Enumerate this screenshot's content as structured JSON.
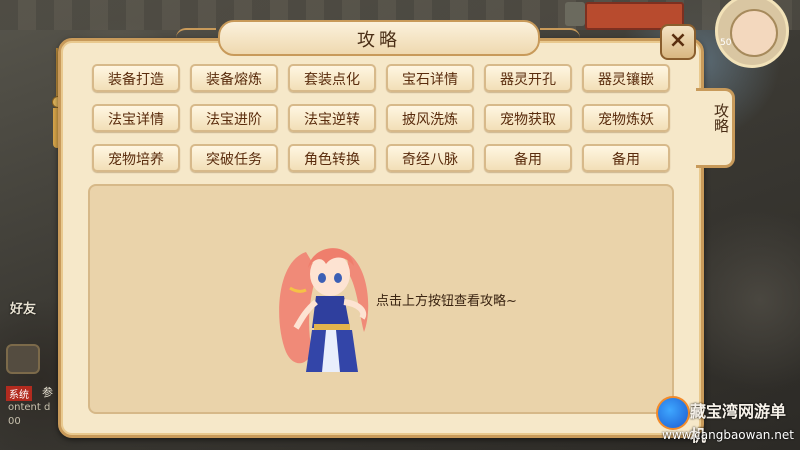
{
  "dialog": {
    "title": "攻略",
    "close_label": "×",
    "side_tab_label": "攻略",
    "hint": "点击上方按钮查看攻略~"
  },
  "guide_buttons": [
    "装备打造",
    "装备熔炼",
    "套装点化",
    "宝石详情",
    "器灵开孔",
    "器灵镶嵌",
    "法宝详情",
    "法宝进阶",
    "法宝逆转",
    "披风洗炼",
    "宠物获取",
    "宠物炼妖",
    "宠物培养",
    "突破任务",
    "角色转换",
    "奇经八脉",
    "备用",
    "备用"
  ],
  "background": {
    "friend_label": "好友",
    "chat_tag": "系统",
    "chat_tag_text": "参",
    "chat_line1": "ontent d",
    "chat_line2": "00",
    "avatar_level": "50"
  },
  "watermark": {
    "name": "藏宝湾网游单机",
    "url": "www.cangbaowan.net"
  },
  "colors": {
    "panel": "#f6e8c9",
    "border": "#c89a5a",
    "button_text": "#5a2c0d",
    "content_bg": "#ead3aa"
  }
}
